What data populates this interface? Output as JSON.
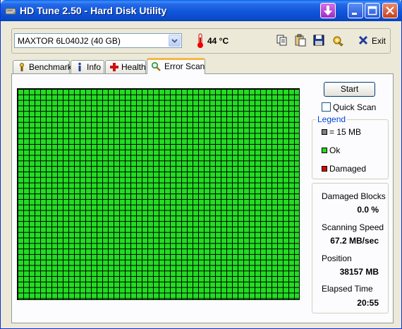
{
  "window": {
    "title": "HD Tune 2.50 - Hard Disk Utility"
  },
  "toolbar": {
    "drive_selected": "MAXTOR 6L040J2 (40 GB)",
    "temperature": "44 °C",
    "exit_label": "Exit"
  },
  "tabs": [
    {
      "label": "Benchmark",
      "icon": "benchmark-icon",
      "active": false
    },
    {
      "label": "Info",
      "icon": "info-icon",
      "active": false
    },
    {
      "label": "Health",
      "icon": "health-cross-icon",
      "active": false
    },
    {
      "label": "Error Scan",
      "icon": "magnifier-icon",
      "active": true
    }
  ],
  "scan": {
    "start_label": "Start",
    "quick_scan_label": "Quick Scan",
    "quick_scan_checked": false,
    "block_color_ok": "#22dd22"
  },
  "legend": {
    "title": "Legend",
    "items": [
      {
        "label": "= 15 MB",
        "color": "#808080"
      },
      {
        "label": "Ok",
        "color": "#22dd22"
      },
      {
        "label": "Damaged",
        "color": "#e00000"
      }
    ]
  },
  "stats": {
    "damaged_blocks_label": "Damaged Blocks",
    "damaged_blocks_value": "0.0 %",
    "scanning_speed_label": "Scanning Speed",
    "scanning_speed_value": "67.2 MB/sec",
    "position_label": "Position",
    "position_value": "38157 MB",
    "elapsed_time_label": "Elapsed Time",
    "elapsed_time_value": "20:55"
  }
}
